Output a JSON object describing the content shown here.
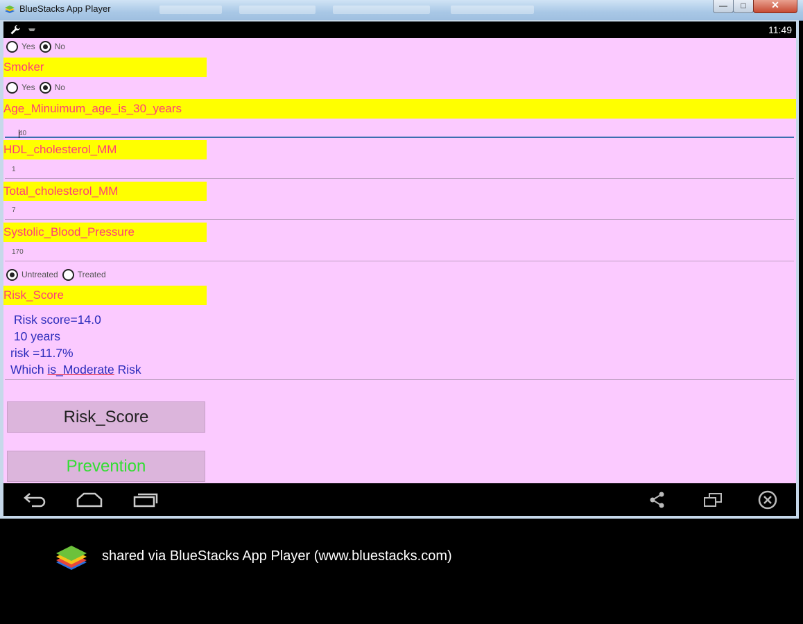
{
  "window": {
    "title": "BlueStacks App Player",
    "minimize_glyph": "—",
    "maximize_glyph": "□",
    "close_glyph": "✕"
  },
  "statusbar": {
    "time": "11:49",
    "icons": [
      "wrench-icon",
      "usb-icon"
    ]
  },
  "form": {
    "q1": {
      "yes": "Yes",
      "no": "No",
      "selected": "No"
    },
    "smoker": {
      "label": "Smoker",
      "yes": "Yes",
      "no": "No",
      "selected": "No"
    },
    "age": {
      "label": "Age_Minuimum_age_is_30_years",
      "value": "40"
    },
    "hdl": {
      "label": "HDL_cholesterol_MM",
      "value": "1"
    },
    "total": {
      "label": "Total_cholesterol_MM",
      "value": "7"
    },
    "sbp": {
      "label": "Systolic_Blood_Pressure",
      "value": "170"
    },
    "treatment": {
      "untreated": "Untreated",
      "treated": "Treated",
      "selected": "Untreated"
    },
    "risk_label": "Risk_Score"
  },
  "result": {
    "line1": " Risk score=14.0",
    "line2": " 10 years",
    "line3": "risk =11.7%",
    "line4_a": "Which ",
    "line4_b": "is_Moderate",
    "line4_c": " Risk"
  },
  "buttons": {
    "risk_score": "Risk_Score",
    "prevention": "Prevention"
  },
  "navbar": {
    "icons": [
      "back-icon",
      "home-icon",
      "recent-apps-icon",
      "share-icon",
      "screen-rotate-icon",
      "close-circle-icon"
    ]
  },
  "share": {
    "text": "shared via BlueStacks App Player (www.bluestacks.com)"
  },
  "colors": {
    "app_background": "#fbcaff",
    "label_highlight": "#ffff00",
    "label_text": "#ff3d7a",
    "result_text": "#2b2bbb",
    "prevention_text": "#33dd33"
  }
}
